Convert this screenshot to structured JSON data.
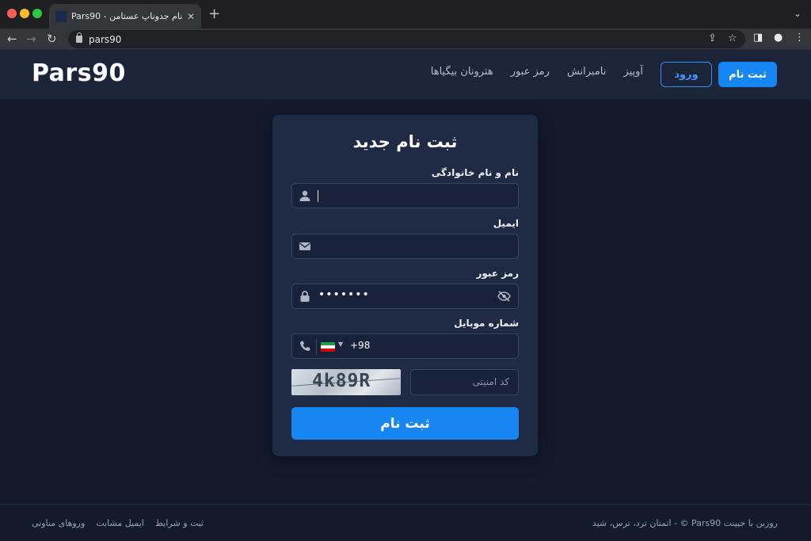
{
  "browser": {
    "tab_title": "Pars90 - ثبت نام جدوناپ عستامن",
    "url": "pars90",
    "close_glyph": "✕",
    "new_tab_glyph": "+"
  },
  "site": {
    "logo": "Pars90",
    "nav": [
      "آوپیز",
      "نامبرانش",
      "رمز عبور",
      "هترونان بیگیاها"
    ],
    "login_label": "ورود",
    "signup_label": "ثبت نام"
  },
  "form": {
    "title": "ثبت نام جدید",
    "name_label": "نام و نام خانوادگی",
    "email_label": "ایمیل",
    "password_label": "رمز عبور",
    "password_value": "•••••••",
    "phone_label": "شماره موبایل",
    "phone_dial": "+98",
    "captcha_text": "4k89R",
    "captcha_placeholder": "کد امنیتی",
    "submit_label": "ثبت نام"
  },
  "footer": {
    "links": [
      "ثبت و شرایط",
      "ایمیل مشابت",
      "وروهای مناونی"
    ],
    "copyright": "روزبن با جبینت Pars90 © - اتمتان ترد، ترس، شید"
  },
  "colors": {
    "accent": "#1785f2",
    "background": "#121a2c",
    "card": "#1f2b44"
  },
  "icons": [
    "user-icon",
    "envelope-icon",
    "lock-icon",
    "eye-slash-icon",
    "phone-icon",
    "iran-flag-icon"
  ]
}
